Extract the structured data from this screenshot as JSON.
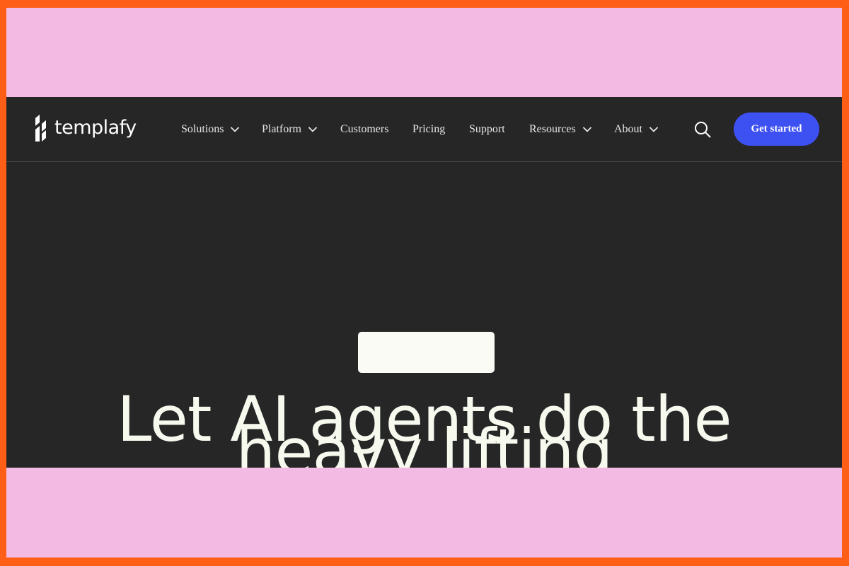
{
  "logo": {
    "text": "templafy"
  },
  "nav": {
    "items": [
      {
        "label": "Solutions",
        "has_dropdown": true
      },
      {
        "label": "Platform",
        "has_dropdown": true
      },
      {
        "label": "Customers",
        "has_dropdown": false
      },
      {
        "label": "Pricing",
        "has_dropdown": false
      },
      {
        "label": "Support",
        "has_dropdown": false
      },
      {
        "label": "Resources",
        "has_dropdown": true
      },
      {
        "label": "About",
        "has_dropdown": true
      }
    ],
    "search_icon": "search-icon",
    "cta_label": "Get started"
  },
  "hero": {
    "title_line1": "Let AI agents do the",
    "title_line2": "heavy lifting"
  },
  "colors": {
    "outer_border": "#ff5e17",
    "frame": "#f3bbe3",
    "page_bg": "#262626",
    "cta_bg": "#3d51f2",
    "text_light": "#f6f9ee"
  }
}
